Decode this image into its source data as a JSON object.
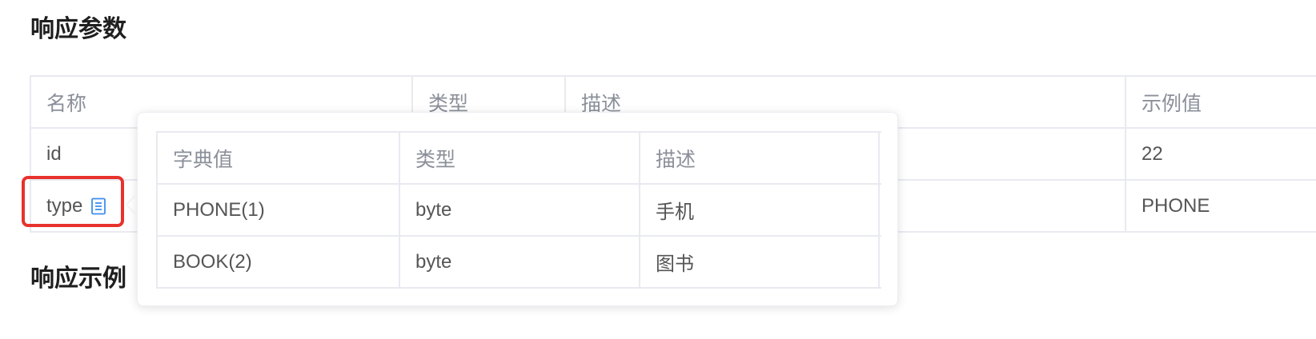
{
  "sections": {
    "response_params_title": "响应参数",
    "response_example_title": "响应示例"
  },
  "params_table": {
    "headers": {
      "name": "名称",
      "type": "类型",
      "description": "描述",
      "example": "示例值"
    },
    "rows": [
      {
        "name": "id",
        "type": "",
        "description": "",
        "example": "22"
      },
      {
        "name": "type",
        "type": "",
        "description": "",
        "example": "PHONE",
        "icon": "document-icon"
      }
    ]
  },
  "dict_popover": {
    "headers": {
      "value": "字典值",
      "type": "类型",
      "description": "描述"
    },
    "rows": [
      {
        "value": "PHONE(1)",
        "type": "byte",
        "description": "手机"
      },
      {
        "value": "BOOK(2)",
        "type": "byte",
        "description": "图书"
      }
    ]
  },
  "colors": {
    "highlight": "#e8322c",
    "icon": "#3d8ef0",
    "border": "#e8eaf0"
  }
}
